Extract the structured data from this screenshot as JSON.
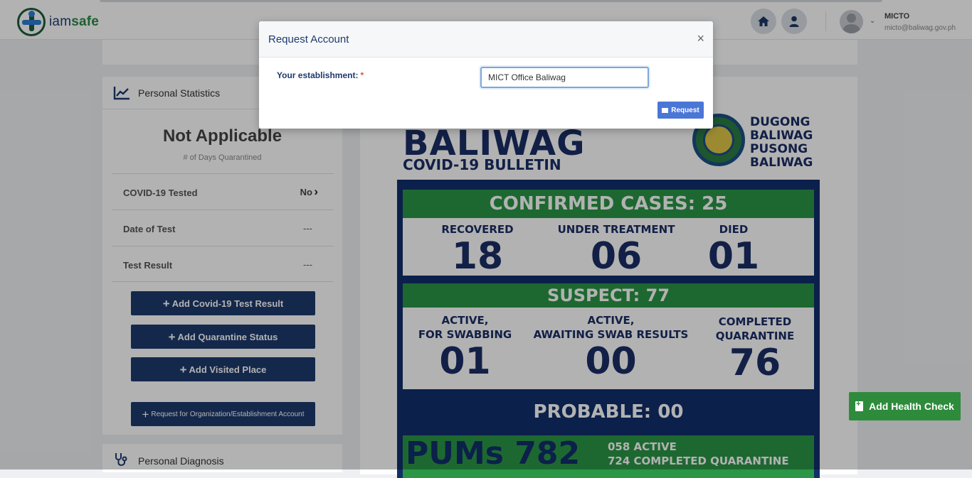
{
  "app": {
    "brand_part1": "iam",
    "brand_part2": "safe",
    "user_name": "MICTO",
    "user_email": "micto@baliwag.gov.ph"
  },
  "icons": {
    "home": "home-icon",
    "user": "user-icon",
    "stats": "chart-line-icon",
    "diagnosis": "stethoscope-icon",
    "close": "close-icon",
    "envelope": "envelope-icon",
    "plus": "plus-icon",
    "chevron": "chevron-right-icon",
    "file_medical": "file-medical-icon"
  },
  "colors": {
    "navy": "#1d3a6d",
    "green": "#2e8b3c",
    "request_blue": "#4a76d6",
    "required_red": "#d9534f"
  },
  "personal_statistics": {
    "header": "Personal Statistics",
    "status_title": "Not Applicable",
    "status_caption": "# of Days Quarantined",
    "rows": [
      {
        "label": "COVID-19 Tested",
        "value": "No"
      },
      {
        "label": "Date of Test",
        "value": "---"
      },
      {
        "label": "Test Result",
        "value": "---"
      }
    ],
    "buttons": {
      "add_test": "Add Covid-19 Test Result",
      "add_quarantine": "Add Quarantine Status",
      "add_visited": "Add Visited Place",
      "request_org": "Request for Organization/Establishment Account"
    }
  },
  "personal_diagnosis": {
    "header": "Personal Diagnosis"
  },
  "bulletin": {
    "title": "BALIWAG",
    "subtitle": "COVID-19 BULLETIN",
    "slogan": [
      "DUGONG",
      "BALIWAG",
      "PUSONG",
      "BALIWAG"
    ],
    "confirmed": "CONFIRMED CASES: 25",
    "confirmed_cols": [
      {
        "label": "RECOVERED",
        "value": "18"
      },
      {
        "label": "UNDER TREATMENT",
        "value": "06"
      },
      {
        "label": "DIED",
        "value": "01"
      }
    ],
    "suspect": "SUSPECT: 77",
    "suspect_cols": [
      {
        "label1": "ACTIVE,",
        "label2": "FOR SWABBING",
        "value": "01"
      },
      {
        "label1": "ACTIVE,",
        "label2": "AWAITING SWAB RESULTS",
        "value": "00"
      },
      {
        "label1": "COMPLETED",
        "label2": "QUARANTINE",
        "value": "76"
      }
    ],
    "probable": "PROBABLE: 00",
    "pums": "PUMs 782",
    "pums_active": "058  ACTIVE",
    "pums_completed": "724  COMPLETED QUARANTINE"
  },
  "modal": {
    "title": "Request Account",
    "close_glyph": "×",
    "field_label": "Your establishment:",
    "required_mark": "*",
    "field_value": "MICT Office Baliwag",
    "submit_label": "Request"
  },
  "floating": {
    "add_health_check": "Add Health Check"
  }
}
